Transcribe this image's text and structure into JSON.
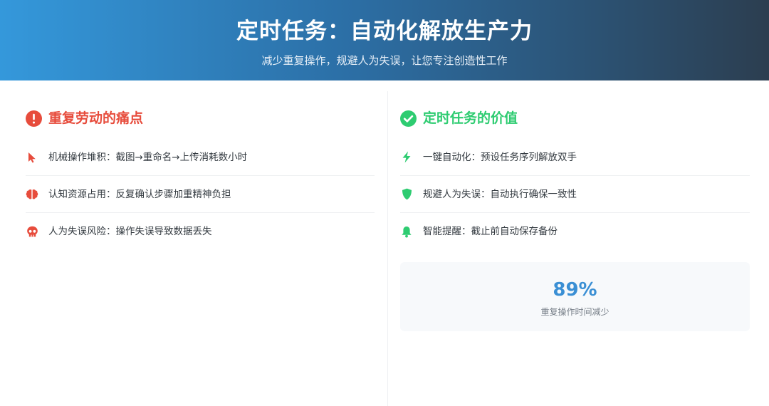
{
  "header": {
    "title": "定时任务：自动化解放生产力",
    "subtitle": "减少重复操作，规避人为失误，让您专注创造性工作"
  },
  "pain_points": {
    "title": "重复劳动的痛点",
    "icon": "exclamation-circle-icon",
    "accent_color": "#e74c3c",
    "items": [
      {
        "icon": "cursor-pointer-icon",
        "text": "机械操作堆积：截图→重命名→上传消耗数小时"
      },
      {
        "icon": "brain-icon",
        "text": "认知资源占用：反复确认步骤加重精神负担"
      },
      {
        "icon": "skull-icon",
        "text": "人为失误风险：操作失误导致数据丢失"
      }
    ]
  },
  "value": {
    "title": "定时任务的价值",
    "icon": "check-circle-icon",
    "accent_color": "#2ecc71",
    "items": [
      {
        "icon": "lightning-bolt-icon",
        "text": "一键自动化：预设任务序列解放双手"
      },
      {
        "icon": "shield-icon",
        "text": "规避人为失误：自动执行确保一致性"
      },
      {
        "icon": "bell-icon",
        "text": "智能提醒：截止前自动保存备份"
      }
    ],
    "stat": {
      "value": "89%",
      "label": "重复操作时间减少"
    }
  }
}
